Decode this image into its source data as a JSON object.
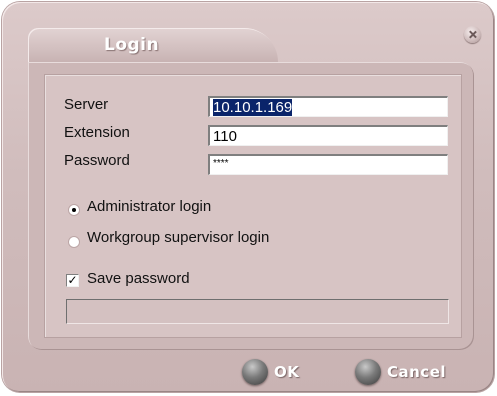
{
  "dialog": {
    "title": "Login",
    "close_icon": "close-icon"
  },
  "form": {
    "server_label": "Server",
    "server_value": "10.10.1.169",
    "extension_label": "Extension",
    "extension_value": "110",
    "password_label": "Password",
    "password_value": "****"
  },
  "login_type": {
    "options": [
      {
        "label": "Administrator login",
        "selected": true
      },
      {
        "label": "Workgroup supervisor login",
        "selected": false
      }
    ]
  },
  "save_password": {
    "label": "Save password",
    "checked": true,
    "check_glyph": "✓"
  },
  "status": {
    "message": ""
  },
  "buttons": {
    "ok_label": "OK",
    "cancel_label": "Cancel"
  },
  "colors": {
    "window_background": "#d0bcbc",
    "selection_highlight": "#0a246a",
    "button_text": "#ffffff"
  }
}
